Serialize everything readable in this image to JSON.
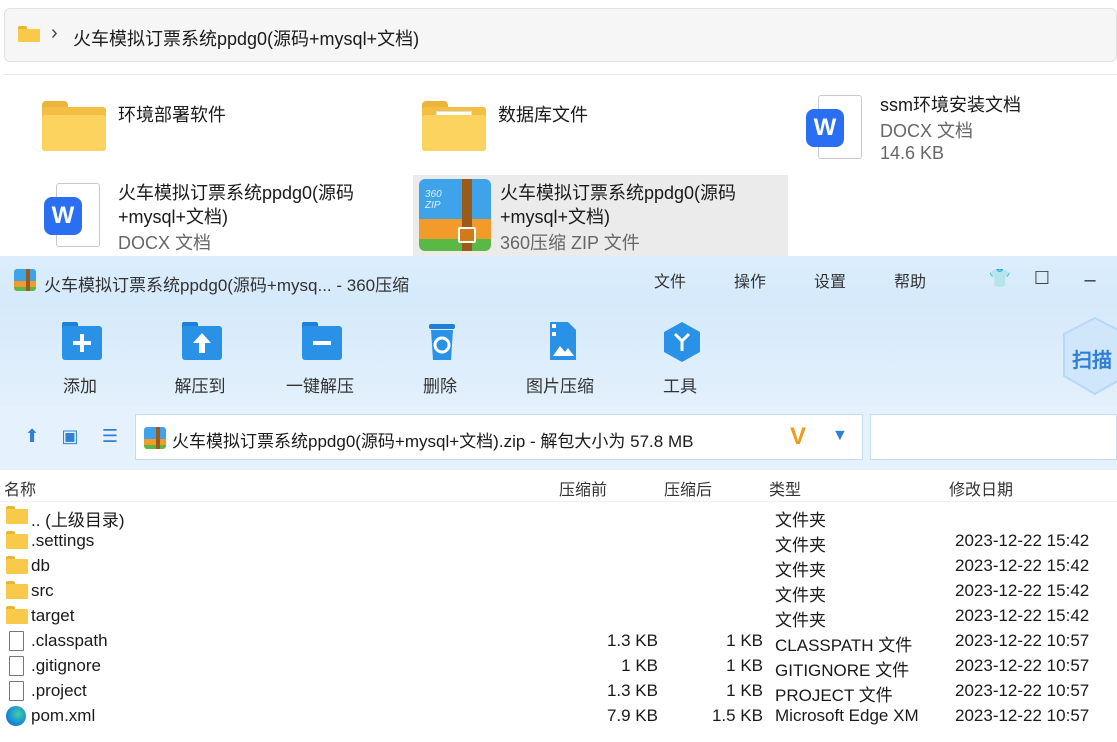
{
  "explorer": {
    "breadcrumb": "火车模拟订票系统ppdg0(源码+mysql+文档)",
    "items": [
      {
        "name": "环境部署软件",
        "sub1": "",
        "sub2": ""
      },
      {
        "name": "数据库文件",
        "sub1": "",
        "sub2": ""
      },
      {
        "name": "ssm环境安装文档",
        "sub1": "DOCX 文档",
        "sub2": "14.6 KB"
      },
      {
        "name": "火车模拟订票系统ppdg0(源码",
        "name2": "+mysql+文档)",
        "sub1": "DOCX 文档"
      },
      {
        "name": "火车模拟订票系统ppdg0(源码",
        "name2": "+mysql+文档)",
        "sub1": "360压缩 ZIP 文件"
      }
    ],
    "docx_badge": "W",
    "zip_badge": "360\nZIP"
  },
  "zipwin": {
    "title": "火车模拟订票系统ppdg0(源码+mysq... - 360压缩",
    "menus": [
      "文件",
      "操作",
      "设置",
      "帮助"
    ],
    "scan_label": "扫描",
    "tools": [
      "添加",
      "解压到",
      "一键解压",
      "删除",
      "图片压缩",
      "工具"
    ],
    "path": "火车模拟订票系统ppdg0(源码+mysql+文档).zip - 解包大小为 57.8 MB",
    "columns": [
      "名称",
      "压缩前",
      "压缩后",
      "类型",
      "修改日期"
    ],
    "rows": [
      {
        "icon": "folder",
        "name": ".. (上级目录)",
        "before": "",
        "after": "",
        "type": "文件夹",
        "date": ""
      },
      {
        "icon": "folder",
        "name": ".settings",
        "before": "",
        "after": "",
        "type": "文件夹",
        "date": "2023-12-22 15:42"
      },
      {
        "icon": "folder",
        "name": "db",
        "before": "",
        "after": "",
        "type": "文件夹",
        "date": "2023-12-22 15:42"
      },
      {
        "icon": "folder",
        "name": "src",
        "before": "",
        "after": "",
        "type": "文件夹",
        "date": "2023-12-22 15:42"
      },
      {
        "icon": "folder",
        "name": "target",
        "before": "",
        "after": "",
        "type": "文件夹",
        "date": "2023-12-22 15:42"
      },
      {
        "icon": "file",
        "name": ".classpath",
        "before": "1.3 KB",
        "after": "1 KB",
        "type": "CLASSPATH 文件",
        "date": "2023-12-22 10:57"
      },
      {
        "icon": "file",
        "name": ".gitignore",
        "before": "1 KB",
        "after": "1 KB",
        "type": "GITIGNORE 文件",
        "date": "2023-12-22 10:57"
      },
      {
        "icon": "file",
        "name": ".project",
        "before": "1.3 KB",
        "after": "1 KB",
        "type": "PROJECT 文件",
        "date": "2023-12-22 10:57"
      },
      {
        "icon": "edge",
        "name": "pom.xml",
        "before": "7.9 KB",
        "after": "1.5 KB",
        "type": "Microsoft Edge XM",
        "date": "2023-12-22 10:57"
      }
    ]
  },
  "colors": {
    "folder": "#f9c94a",
    "accent": "#2f7fd5",
    "titlebar": "#d4e9fb",
    "docx": "#2a6ef2"
  }
}
